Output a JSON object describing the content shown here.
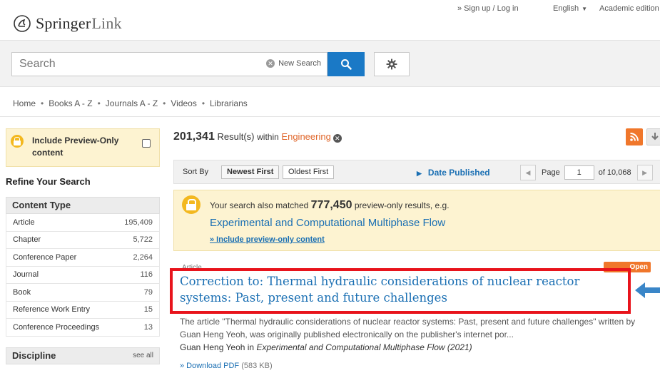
{
  "header": {
    "logo_bold": "Springer",
    "logo_light": "Link",
    "signup": "» Sign up / Log in",
    "language": "English",
    "academic": "Academic edition"
  },
  "search": {
    "placeholder": "Search",
    "new_search": "New Search"
  },
  "nav": [
    "Home",
    "Books A - Z",
    "Journals A - Z",
    "Videos",
    "Librarians"
  ],
  "sidebar": {
    "preview_label": "Include Preview-Only content",
    "refine_title": "Refine Your Search",
    "content_type": {
      "title": "Content Type",
      "items": [
        {
          "label": "Article",
          "count": "195,409"
        },
        {
          "label": "Chapter",
          "count": "5,722"
        },
        {
          "label": "Conference Paper",
          "count": "2,264"
        },
        {
          "label": "Journal",
          "count": "116"
        },
        {
          "label": "Book",
          "count": "79"
        },
        {
          "label": "Reference Work Entry",
          "count": "15"
        },
        {
          "label": "Conference Proceedings",
          "count": "13"
        }
      ]
    },
    "discipline": {
      "title": "Discipline",
      "see_all": "see all"
    }
  },
  "results": {
    "count": "201,341",
    "result_label": "Result(s)",
    "within": "within",
    "discipline": "Engineering"
  },
  "sort": {
    "label": "Sort By",
    "newest": "Newest First",
    "oldest": "Oldest First",
    "date_published": "Date Published",
    "page_label": "Page",
    "page_value": "1",
    "of_pages": "of 10,068"
  },
  "notice": {
    "text_pre": "Your search also matched",
    "count": "777,450",
    "text_post": "preview-only results, e.g.",
    "example_title": "Experimental and Computational Multiphase Flow",
    "include_link": "» Include preview-only content"
  },
  "first_result": {
    "badge": "Open Access",
    "content_type": "Article",
    "title": "Correction to: Thermal hydraulic considerations of nuclear reactor systems: Past, present and future challenges",
    "snippet": "The article \"Thermal hydraulic considerations of nuclear reactor systems: Past, present and future challenges\" written by Guan Heng Yeoh, was originally published electronically on the publisher's internet por...",
    "author": "Guan Heng Yeoh",
    "in_word": "in",
    "publication": "Experimental and Computational Multiphase Flow (2021)",
    "download": "» Download PDF",
    "size": "(583 KB)"
  },
  "colors": {
    "accent_blue": "#1a6fb3",
    "search_button": "#1a79c6",
    "orange": "#e0662a",
    "highlight_red": "#e8141c",
    "preview_yellow": "#fdf3d1"
  }
}
